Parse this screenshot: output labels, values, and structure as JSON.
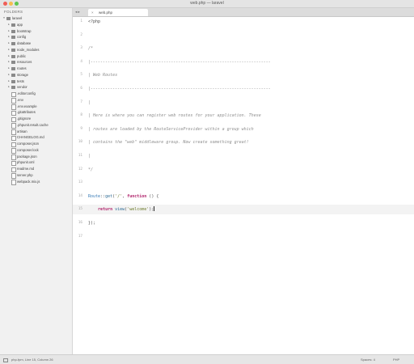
{
  "window": {
    "title": "web.php — laravel"
  },
  "sidebar": {
    "header": "FOLDERS",
    "root": "laravel",
    "folders": [
      "app",
      "bootstrap",
      "config",
      "database",
      "node_modules",
      "public",
      "resources",
      "routes",
      "storage",
      "tests",
      "vendor"
    ],
    "files": [
      ".editorconfig",
      ".env",
      ".env.example",
      ".gitattributes",
      ".gitignore",
      ".phpunit.result.cache",
      "artisan",
      "CHANGELOG.md",
      "composer.json",
      "composer.lock",
      "package.json",
      "phpunit.xml",
      "readme.md",
      "server.php",
      "webpack.mix.js"
    ]
  },
  "tabbar": {
    "nav": "◂ ▸",
    "tab": {
      "close": "×",
      "label": "web.php"
    }
  },
  "editor": {
    "lines": [
      {
        "n": "1",
        "kind": "plain",
        "text": "<?php"
      },
      {
        "n": "2",
        "kind": "plain",
        "text": ""
      },
      {
        "n": "3",
        "kind": "comment",
        "text": "/*"
      },
      {
        "n": "4",
        "kind": "comment",
        "text": "|--------------------------------------------------------------------------"
      },
      {
        "n": "5",
        "kind": "comment",
        "text": "| Web Routes"
      },
      {
        "n": "6",
        "kind": "comment",
        "text": "|--------------------------------------------------------------------------"
      },
      {
        "n": "7",
        "kind": "comment",
        "text": "|"
      },
      {
        "n": "8",
        "kind": "comment",
        "text": "| Here is where you can register web routes for your application. These"
      },
      {
        "n": "9",
        "kind": "comment",
        "text": "| routes are loaded by the RouteServiceProvider within a group which"
      },
      {
        "n": "10",
        "kind": "comment",
        "text": "| contains the \"web\" middleware group. Now create something great!"
      },
      {
        "n": "11",
        "kind": "comment",
        "text": "|"
      },
      {
        "n": "12",
        "kind": "comment",
        "text": "*/"
      },
      {
        "n": "13",
        "kind": "plain",
        "text": ""
      },
      {
        "n": "14",
        "kind": "tokens",
        "tokens": [
          {
            "t": "Route",
            "c": "tok-class"
          },
          {
            "t": "::",
            "c": "tok-plain"
          },
          {
            "t": "get",
            "c": "tok-fn"
          },
          {
            "t": "(",
            "c": "tok-plain"
          },
          {
            "t": "'/'",
            "c": "tok-str"
          },
          {
            "t": ", ",
            "c": "tok-plain"
          },
          {
            "t": "function",
            "c": "tok-kw"
          },
          {
            "t": " () {",
            "c": "tok-plain"
          }
        ]
      },
      {
        "n": "15",
        "kind": "tokens",
        "current": true,
        "tokens": [
          {
            "t": "    ",
            "c": "tok-plain"
          },
          {
            "t": "return",
            "c": "tok-kw"
          },
          {
            "t": " ",
            "c": "tok-plain"
          },
          {
            "t": "view",
            "c": "tok-fn"
          },
          {
            "t": "(",
            "c": "tok-plain"
          },
          {
            "t": "'welcome'",
            "c": "tok-str"
          },
          {
            "t": ");",
            "c": "tok-plain"
          }
        ]
      },
      {
        "n": "16",
        "kind": "plain",
        "text": "});"
      },
      {
        "n": "17",
        "kind": "plain",
        "text": ""
      }
    ]
  },
  "statusbar": {
    "position": "php-fpm, Line 15, Column 26",
    "indent": "Spaces: 4",
    "syntax": "PHP"
  }
}
